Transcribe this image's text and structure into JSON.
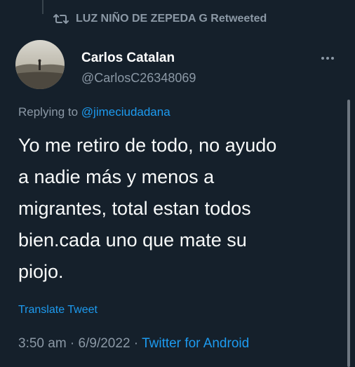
{
  "retweet": {
    "label": "LUZ NIÑO DE ZEPEDA G Retweeted"
  },
  "author": {
    "name": "Carlos Catalan",
    "handle": "@CarlosC26348069"
  },
  "reply": {
    "prefix": "Replying to ",
    "mention": "@jimeciudadana"
  },
  "tweet": {
    "text": "Yo me retiro de todo, no ayudo\na nadie más y menos a\nmigrantes, total estan todos\nbien.cada uno que mate su\npiojo."
  },
  "translate_label": "Translate Tweet",
  "meta": {
    "time": "3:50 am",
    "separator": " · ",
    "date": "6/9/2022",
    "source": "Twitter for Android"
  },
  "colors": {
    "background": "#15202b",
    "muted": "#8b98a5",
    "accent": "#1d9bf0"
  }
}
